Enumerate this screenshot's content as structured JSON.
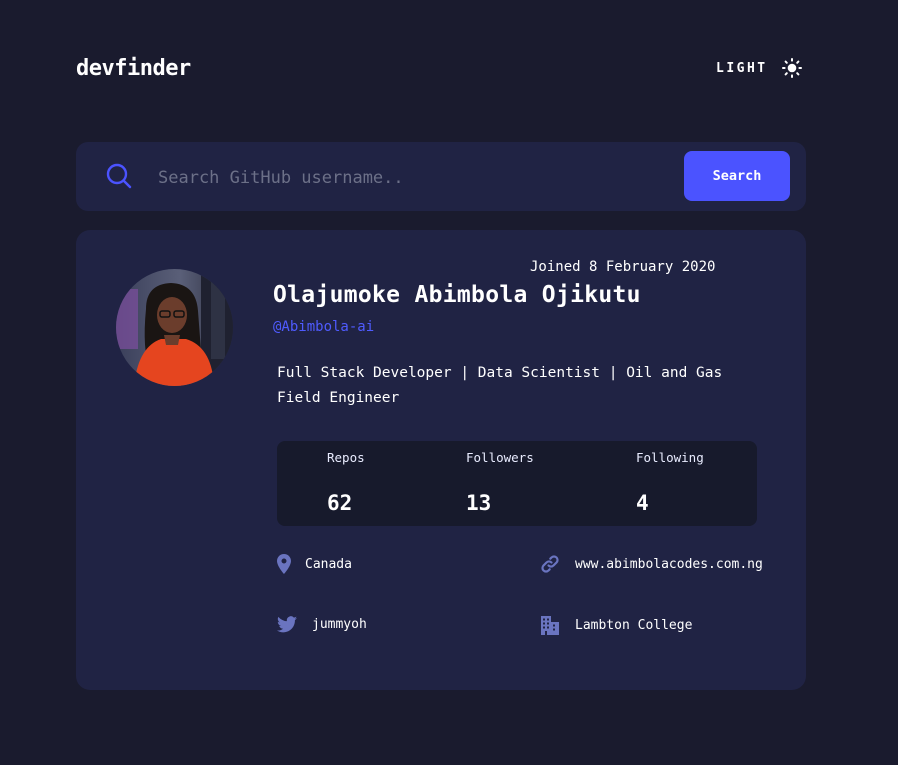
{
  "app": {
    "logo": "devfinder"
  },
  "theme_toggle": {
    "label": "LIGHT",
    "icon": "sun-icon"
  },
  "search": {
    "placeholder": "Search GitHub username..",
    "value": "",
    "button_label": "Search",
    "icon": "search-icon"
  },
  "profile": {
    "joined": "Joined 8 February 2020",
    "name": "Olajumoke Abimbola Ojikutu",
    "login": "@Abimbola-ai",
    "bio": "Full Stack Developer | Data Scientist | Oil and Gas Field Engineer",
    "stats": [
      {
        "label": "Repos",
        "value": "62"
      },
      {
        "label": "Followers",
        "value": "13"
      },
      {
        "label": "Following",
        "value": "4"
      }
    ],
    "location": "Canada",
    "website": "www.abimbolacodes.com.ng",
    "twitter": "jummyoh",
    "company": "Lambton College"
  },
  "colors": {
    "background": "#1a1b2e",
    "card": "#202344",
    "accent": "#4b53ff",
    "icon": "#6a74c0"
  }
}
